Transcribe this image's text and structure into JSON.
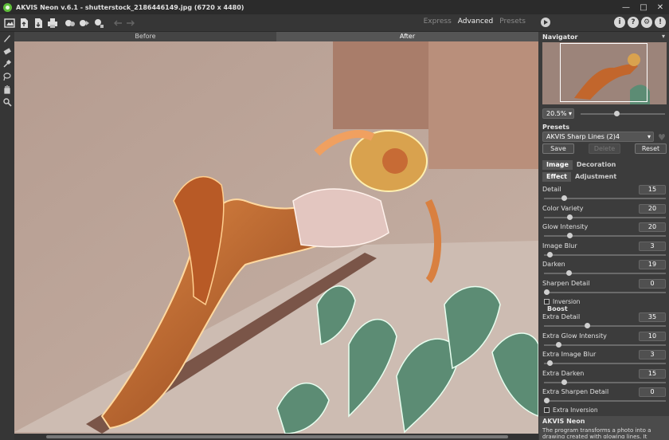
{
  "window": {
    "title": "AKVIS Neon v.6.1 - shutterstock_2186446149.jpg (6720 x 4480)",
    "controls": [
      "minimize-icon",
      "maximize-icon",
      "close-icon"
    ]
  },
  "toolbar": {
    "buttons": [
      "open-image-icon",
      "upload-icon",
      "save-icon",
      "print-icon",
      "settings-batch-icon",
      "import-icon",
      "export-icon",
      "share-icon",
      "undo-icon",
      "redo-icon"
    ],
    "modes": [
      "Express",
      "Advanced",
      "Presets"
    ],
    "active_mode": "Advanced",
    "right_icons": [
      "i",
      "?",
      "⚙",
      "!"
    ]
  },
  "left_tools": [
    "brush-icon",
    "eraser-icon",
    "pipette-icon",
    "lasso-icon",
    "hand-icon",
    "zoom-icon"
  ],
  "view_tabs": [
    "Before",
    "After"
  ],
  "active_view_tab": "After",
  "navigator": {
    "title": "Navigator",
    "zoom": "20.5%",
    "zoom_level": 0.42
  },
  "presets": {
    "title": "Presets",
    "selected": "AKVIS Sharp Lines (2)4",
    "save": "Save",
    "delete": "Delete",
    "reset": "Reset"
  },
  "tabs": {
    "top": [
      "Image",
      "Decoration"
    ],
    "active_top": "Image",
    "sub": [
      "Effect",
      "Adjustment"
    ],
    "active_sub": "Effect"
  },
  "params": [
    {
      "label": "Detail",
      "value": "15",
      "level": 0.15
    },
    {
      "label": "Color Variety",
      "value": "20",
      "level": 0.2
    },
    {
      "label": "Glow Intensity",
      "value": "20",
      "level": 0.2
    },
    {
      "label": "Image Blur",
      "value": "3",
      "level": 0.03
    },
    {
      "label": "Darken",
      "value": "19",
      "level": 0.19
    },
    {
      "label": "Sharpen Detail",
      "value": "0",
      "level": 0.0
    }
  ],
  "inversion_label": "Inversion",
  "boost": {
    "title": "Boost",
    "params": [
      {
        "label": "Extra Detail",
        "value": "35",
        "level": 0.35
      },
      {
        "label": "Extra Glow Intensity",
        "value": "10",
        "level": 0.1
      },
      {
        "label": "Extra Image Blur",
        "value": "3",
        "level": 0.03
      },
      {
        "label": "Extra Darken",
        "value": "15",
        "level": 0.15
      },
      {
        "label": "Extra Sharpen Detail",
        "value": "0",
        "level": 0.0
      }
    ],
    "inversion_label": "Extra Inversion"
  },
  "info": {
    "title": "AKVIS Neon",
    "text": "The program transforms a photo into a drawing created with glowing lines. It brings outstanding"
  },
  "colors": {
    "accent": "#5fbf3a",
    "panel": "#3c3c3c",
    "toolbar": "#363636"
  }
}
